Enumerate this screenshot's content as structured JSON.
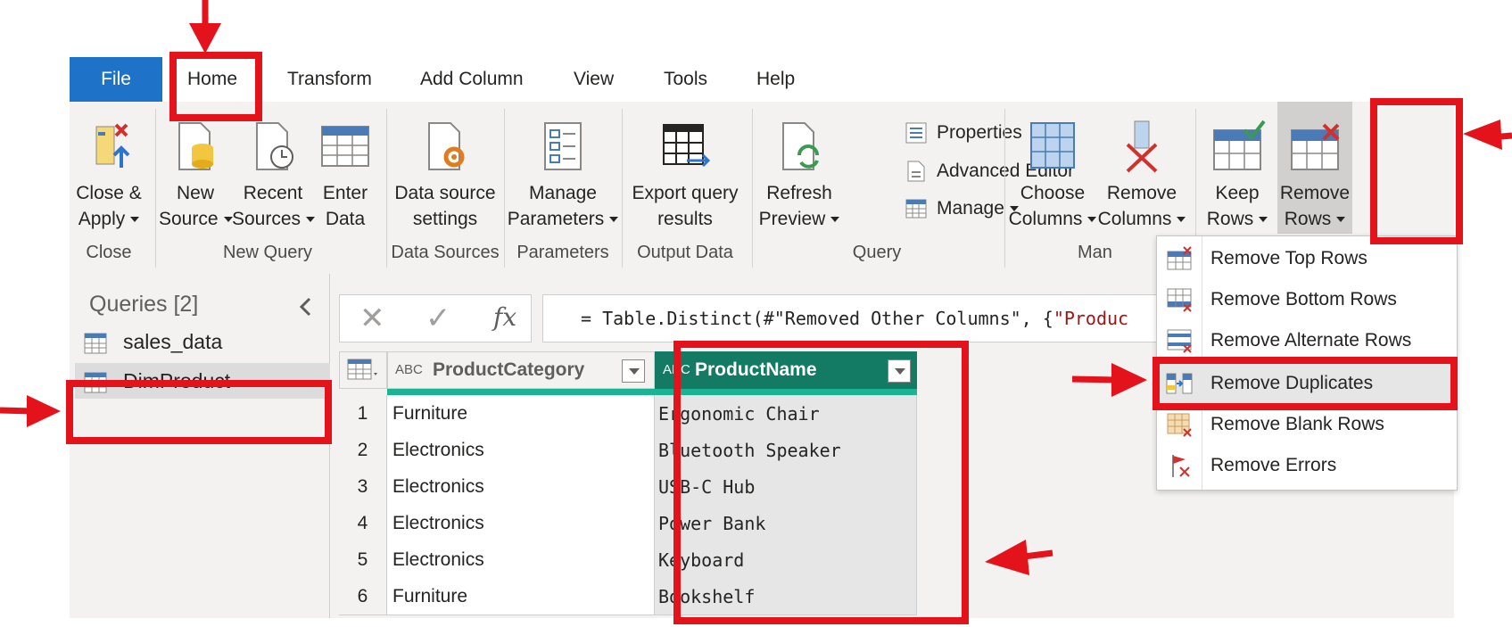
{
  "tabs": [
    "File",
    "Home",
    "Transform",
    "Add Column",
    "View",
    "Tools",
    "Help"
  ],
  "ribbon": {
    "close_apply": [
      "Close &",
      "Apply"
    ],
    "new_source": [
      "New",
      "Source"
    ],
    "recent_sources": [
      "Recent",
      "Sources"
    ],
    "enter_data": [
      "Enter",
      "Data"
    ],
    "data_source_settings": [
      "Data source",
      "settings"
    ],
    "manage_parameters": [
      "Manage",
      "Parameters"
    ],
    "export_query": [
      "Export query",
      "results"
    ],
    "refresh_preview": [
      "Refresh",
      "Preview"
    ],
    "properties": "Properties",
    "advanced_editor": "Advanced Editor",
    "manage": "Manage",
    "choose_columns": [
      "Choose",
      "Columns"
    ],
    "remove_columns": [
      "Remove",
      "Columns"
    ],
    "keep_rows": [
      "Keep",
      "Rows"
    ],
    "remove_rows": [
      "Remove",
      "Rows"
    ],
    "groups": {
      "close": "Close",
      "new_query": "New Query",
      "data_sources": "Data Sources",
      "parameters": "Parameters",
      "output_data": "Output Data",
      "query": "Query",
      "manage_cols": "Man"
    }
  },
  "queries": {
    "title": "Queries [2]",
    "items": [
      "sales_data",
      "DimProduct"
    ]
  },
  "formula": {
    "cancel": "✕",
    "commit": "✓",
    "fx": "fx",
    "text_prefix": "= Table.Distinct(#\"Removed Other Columns\", {",
    "text_string": "\"Produc"
  },
  "table": {
    "columns": [
      "ProductCategory",
      "ProductName"
    ],
    "type_badge": "ABC",
    "rows": [
      {
        "n": "1",
        "category": "Furniture",
        "name": "Ergonomic Chair"
      },
      {
        "n": "2",
        "category": "Electronics",
        "name": "Bluetooth Speaker"
      },
      {
        "n": "3",
        "category": "Electronics",
        "name": "USB-C Hub"
      },
      {
        "n": "4",
        "category": "Electronics",
        "name": "Power Bank"
      },
      {
        "n": "5",
        "category": "Electronics",
        "name": "Keyboard"
      },
      {
        "n": "6",
        "category": "Furniture",
        "name": "Bookshelf"
      }
    ]
  },
  "menu": {
    "items": [
      "Remove Top Rows",
      "Remove Bottom Rows",
      "Remove Alternate Rows",
      "Remove Duplicates",
      "Remove Blank Rows",
      "Remove Errors"
    ]
  },
  "colors": {
    "file_tab": "#1e72c7",
    "selected_column_header": "#137a63",
    "annotation_red": "#e3121b"
  }
}
